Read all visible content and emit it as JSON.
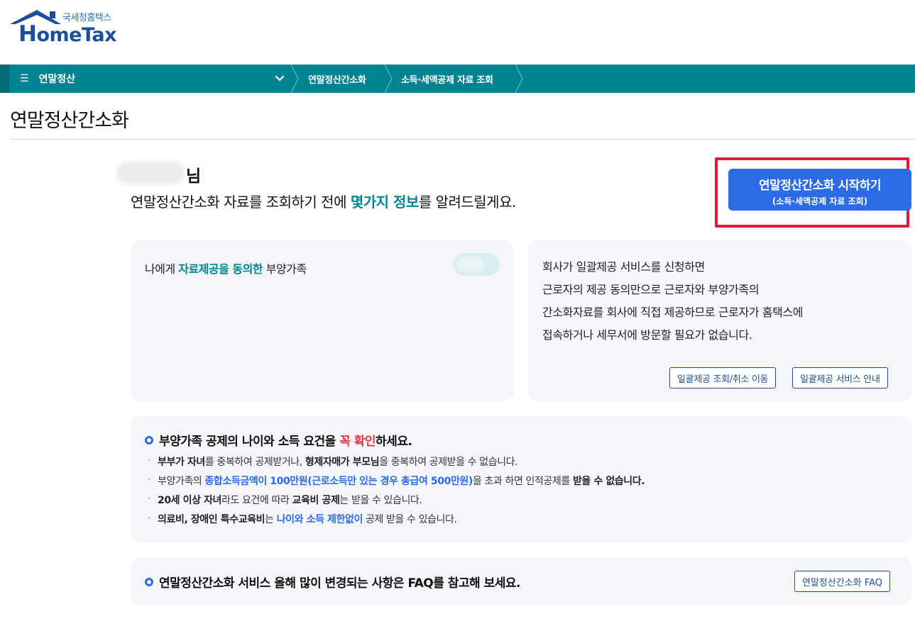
{
  "logo": {
    "subtitle": "국세청홈택스",
    "title_first": "H",
    "title_rest": "omeTax",
    "colors": {
      "primary": "#1b4f9b",
      "accent": "#2a6fb8"
    }
  },
  "nav": {
    "menu_icon": "hamburger-icon",
    "menu_label": "연말정산",
    "breadcrumbs": [
      "연말정산간소화",
      "소득·세액공제 자료 조회"
    ],
    "colors": {
      "bar": "#008391"
    }
  },
  "page": {
    "title": "연말정산간소화"
  },
  "greeting": {
    "name_suffix": "님",
    "line_before": "연말정산간소화 자료를 조회하기 전에 ",
    "line_highlight": "몇가지 정보",
    "line_after": "를 알려드릴게요."
  },
  "start_button": {
    "label": "연말정산간소화 시작하기",
    "sublabel": "(소득·세액공제 자료 조회)",
    "color": "#2b6be6",
    "highlight_color": "#e01b3c"
  },
  "dependents_card": {
    "title_before": "나에게 ",
    "title_highlight": "자료제공을 동의한",
    "title_after": " 부양가족"
  },
  "bulk_card": {
    "lines": [
      "회사가 일괄제공 서비스를 신청하면",
      "근로자의 제공 동의만으로 근로자와 부양가족의",
      "간소화자료를 회사에 직접 제공하므로 근로자가 홈택스에",
      "접속하거나 세무서에 방문할 필요가 없습니다."
    ],
    "buttons": [
      "일괄제공 조회/취소 이동",
      "일괄제공 서비스 안내"
    ]
  },
  "info_card": {
    "heading_before": "부양가족 공제의 나이와 소득 요건을 ",
    "heading_red": "꼭 확인",
    "heading_after": "하세요.",
    "items": [
      {
        "b1": "부부가 자녀",
        "t1": "를 중복하여 공제받거나, ",
        "b2": "형제자매가 부모님",
        "t2": "을 중복하여 공제받을 수 없습니다."
      },
      {
        "t0": "부양가족의 ",
        "blue": "종합소득금액이 100만원(근로소득만 있는 경우 총급여 500만원)",
        "t1": "을 초과 하면 인적공제를 ",
        "b1": "받을 수 없습니다."
      },
      {
        "b1": "20세 이상 자녀",
        "t1": "라도 요건에 따라 ",
        "b2": "교육비 공제",
        "t2": "는 받을 수 있습니다."
      },
      {
        "b1": "의료비, 장애인 특수교육비",
        "t1": "는 ",
        "blue": "나이와 소득 제한없이",
        "t2": " 공제 받을 수 있습니다."
      }
    ]
  },
  "faq_card": {
    "text": "연말정산간소화 서비스 올해 많이 변경되는 사항은 FAQ를 참고해 보세요.",
    "button": "연말정산간소화 FAQ"
  }
}
